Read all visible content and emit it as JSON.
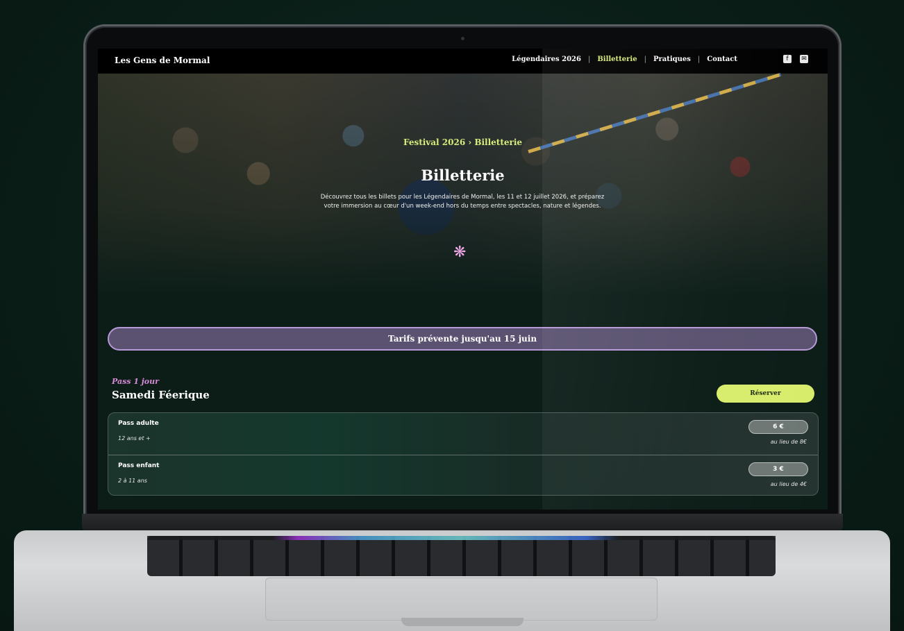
{
  "nav": {
    "brand": "Les Gens de Mormal",
    "items": [
      {
        "label": "Légendaires 2026",
        "active": false
      },
      {
        "label": "Billetterie",
        "active": true
      },
      {
        "label": "Pratiques",
        "active": false
      },
      {
        "label": "Contact",
        "active": false
      }
    ],
    "separator": "|",
    "social": [
      {
        "icon": "facebook-icon",
        "glyph": "f"
      },
      {
        "icon": "mail-icon",
        "glyph": "✉"
      }
    ]
  },
  "hero": {
    "breadcrumb": "Festival 2026 › Billetterie",
    "title": "Billetterie",
    "description": "Découvrez tous les billets pour les Légendaires de Mormal, les 11 et 12 juillet 2026, et préparez votre immersion au cœur d'un week-end hors du temps entre spectacles, nature et légendes.",
    "flower_glyph": "❋"
  },
  "banner": {
    "label": "Tarifs prévente jusqu'au 15 juin"
  },
  "pass": {
    "kicker": "Pass 1 jour",
    "name": "Samedi Féerique",
    "reserve_label": "Réserver",
    "rows": [
      {
        "title": "Pass adulte",
        "subtitle": "12 ans et +",
        "price": "6 €",
        "old_price": "au lieu de 8€"
      },
      {
        "title": "Pass enfant",
        "subtitle": "2 à 11 ans",
        "price": "3 €",
        "old_price": "au lieu de 4€"
      }
    ]
  },
  "colors": {
    "accent_lime": "#d8ec7c",
    "accent_purple": "#b69ad8",
    "accent_pink": "#d68ad8",
    "background": "#0c1d18"
  }
}
